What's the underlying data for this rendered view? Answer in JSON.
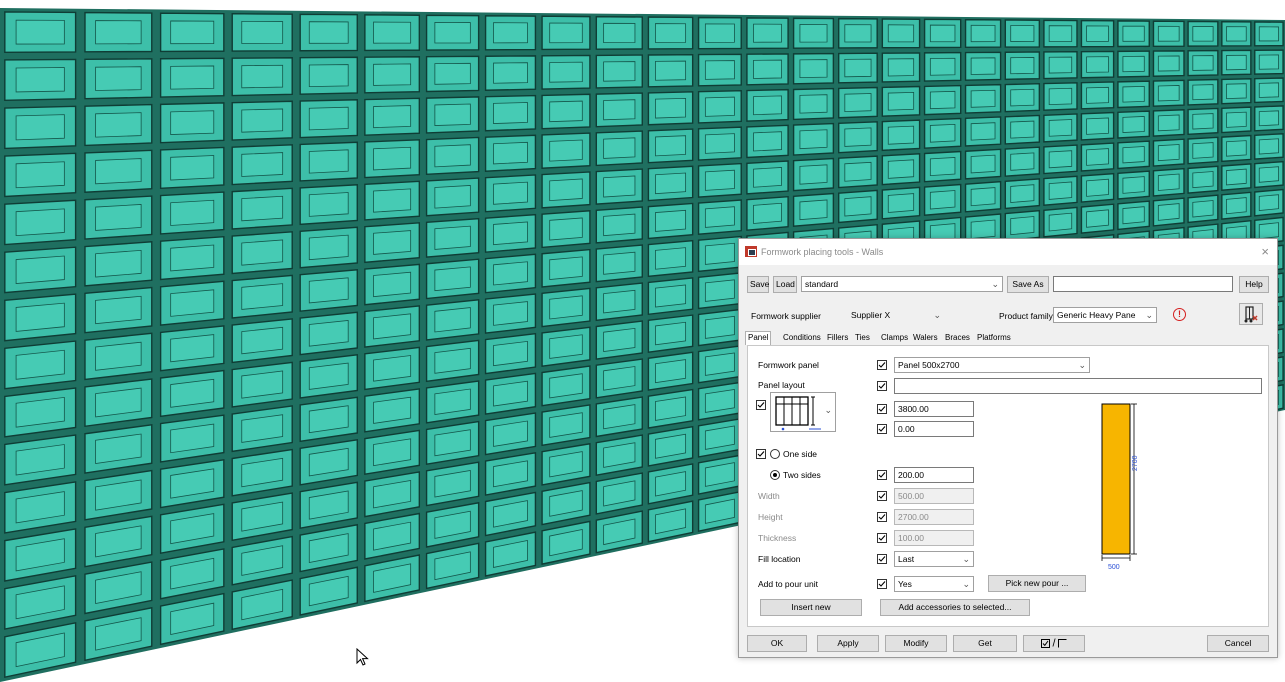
{
  "dialog": {
    "title": "Formwork placing tools - Walls",
    "close_glyph": "×"
  },
  "toolbar": {
    "save_label": "Save",
    "load_label": "Load",
    "preset_value": "standard",
    "save_as_label": "Save As",
    "save_as_value": "",
    "help_label": "Help"
  },
  "supplier": {
    "label": "Formwork supplier",
    "value": "Supplier X",
    "product_family_label": "Product family",
    "product_family_value": "Generic Heavy Pane"
  },
  "tabs": [
    {
      "label": "Panel"
    },
    {
      "label": "Conditions"
    },
    {
      "label": "Fillers"
    },
    {
      "label": "Ties"
    },
    {
      "label": "Clamps"
    },
    {
      "label": "Walers"
    },
    {
      "label": "Braces"
    },
    {
      "label": "Platforms"
    }
  ],
  "panel": {
    "formwork_panel_label": "Formwork panel",
    "formwork_panel_value": "Panel 500x2700",
    "panel_layout_label": "Panel layout",
    "panel_layout_value": "",
    "value_1": "3800.00",
    "value_2": "0.00",
    "one_side_label": "One side",
    "two_sides_label": "Two sides",
    "two_sides_value": "200.00",
    "width_label": "Width",
    "width_value": "500.00",
    "height_label": "Height",
    "height_value": "2700.00",
    "thickness_label": "Thickness",
    "thickness_value": "100.00",
    "fill_location_label": "Fill location",
    "fill_location_value": "Last",
    "add_to_pour_label": "Add to pour unit",
    "add_to_pour_value": "Yes",
    "pick_new_pour_label": "Pick new pour ...",
    "insert_new_label": "Insert new",
    "add_accessories_label": "Add accessories to selected...",
    "preview_height_label": "2700",
    "preview_width_label": "500",
    "preview_fill_color": "#f7b500"
  },
  "footer": {
    "ok_label": "OK",
    "apply_label": "Apply",
    "modify_label": "Modify",
    "get_label": "Get",
    "toggle_label": "/",
    "cancel_label": "Cancel"
  },
  "colors": {
    "panel_teal": "#3dbfa9",
    "panel_teal_dark": "#1f6f60",
    "warning_red": "#d41f1f",
    "dimension_blue": "#2a4fd6"
  }
}
